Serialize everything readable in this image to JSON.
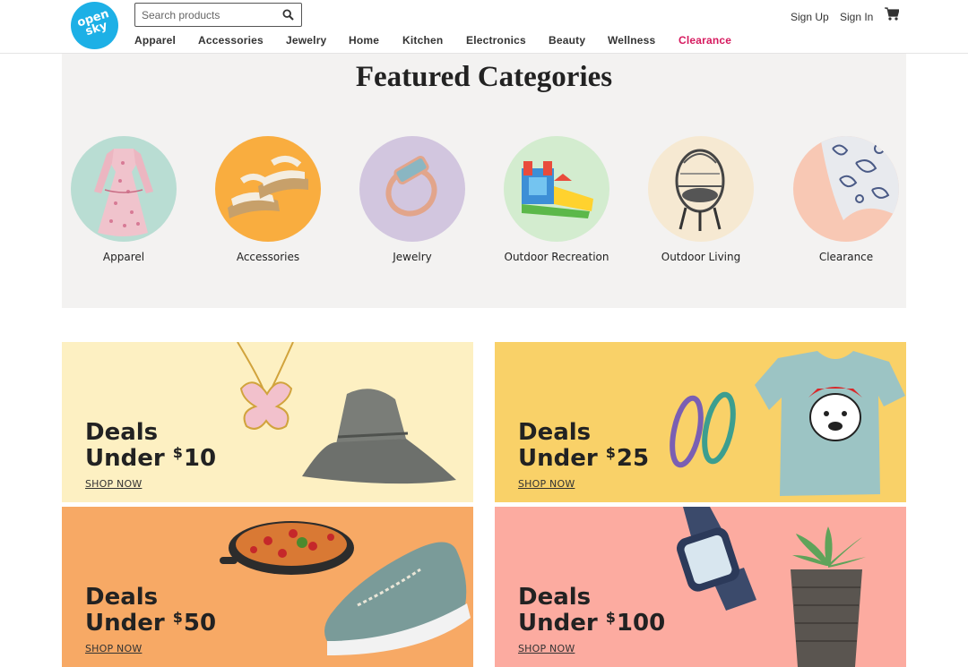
{
  "header": {
    "logo_text": "open\nsky",
    "search": {
      "placeholder": "Search products",
      "value": ""
    },
    "nav": [
      "Apparel",
      "Accessories",
      "Jewelry",
      "Home",
      "Kitchen",
      "Electronics",
      "Beauty",
      "Wellness",
      "Clearance"
    ],
    "sign_up": "Sign Up",
    "sign_in": "Sign In",
    "accent_color": "#d6195e",
    "logo_color": "#1db0e6"
  },
  "featured": {
    "title": "Featured Categories",
    "categories": [
      {
        "label": "Apparel",
        "icon": "dress-image",
        "bg": "#b9ddd3"
      },
      {
        "label": "Accessories",
        "icon": "sandals-image",
        "bg": "#f9ad3f"
      },
      {
        "label": "Jewelry",
        "icon": "ring-image",
        "bg": "#d2c6df"
      },
      {
        "label": "Outdoor Recreation",
        "icon": "bounce-house-image",
        "bg": "#d3eccf"
      },
      {
        "label": "Outdoor Living",
        "icon": "egg-chair-image",
        "bg": "#f6e9d2"
      },
      {
        "label": "Clearance",
        "icon": "paisley-fabric-image",
        "bg": "#f8c8b4"
      }
    ]
  },
  "deals": [
    {
      "line1": "Deals",
      "line2_prefix": "Under",
      "currency": "$",
      "amount": "10",
      "cta": "SHOP NOW",
      "bg": "#fdf0c2"
    },
    {
      "line1": "Deals",
      "line2_prefix": "Under",
      "currency": "$",
      "amount": "25",
      "cta": "SHOP NOW",
      "bg": "#f9d168"
    },
    {
      "line1": "Deals",
      "line2_prefix": "Under",
      "currency": "$",
      "amount": "50",
      "cta": "SHOP NOW",
      "bg": "#f7a965"
    },
    {
      "line1": "Deals",
      "line2_prefix": "Under",
      "currency": "$",
      "amount": "100",
      "cta": "SHOP NOW",
      "bg": "#fcaba0"
    }
  ]
}
